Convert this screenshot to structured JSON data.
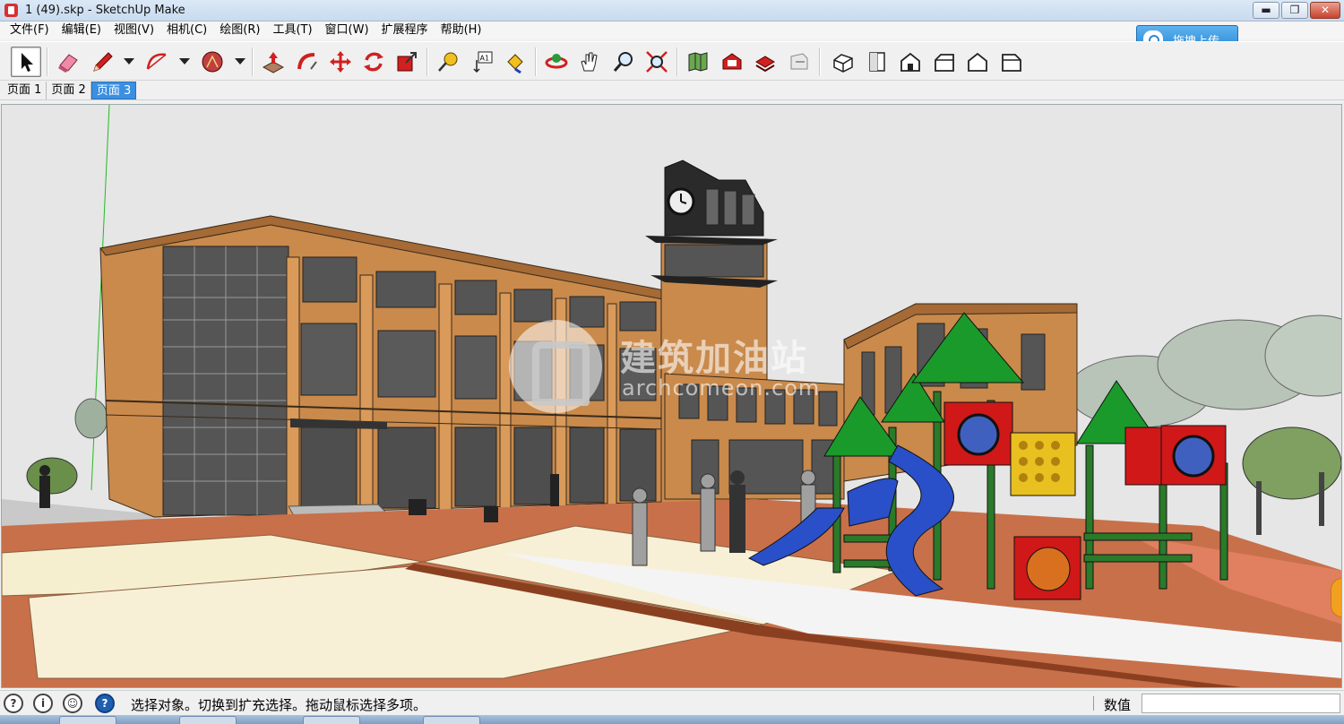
{
  "window": {
    "title": "1 (49).skp - SketchUp Make",
    "buttons": {
      "minimize": "▬",
      "restore": "❐",
      "close": "✕"
    }
  },
  "menu": [
    "文件(F)",
    "编辑(E)",
    "视图(V)",
    "相机(C)",
    "绘图(R)",
    "工具(T)",
    "窗口(W)",
    "扩展程序",
    "帮助(H)"
  ],
  "upload": {
    "label": "拖拽上传",
    "icon": "cloud-upload-icon"
  },
  "toolbar": {
    "tools": [
      {
        "name": "select-tool",
        "icon": "arrow-cursor-icon",
        "active": true
      },
      {
        "name": "eraser-tool",
        "icon": "eraser-icon"
      },
      {
        "name": "line-tool",
        "icon": "pencil-icon"
      },
      {
        "name": "arc-tool",
        "icon": "arc-icon"
      },
      {
        "name": "shape-tool",
        "icon": "polygon-icon"
      },
      {
        "name": "push-pull-tool",
        "icon": "push-pull-icon"
      },
      {
        "name": "follow-me-tool",
        "icon": "follow-me-icon"
      },
      {
        "name": "move-tool",
        "icon": "move-arrows-icon"
      },
      {
        "name": "rotate-tool",
        "icon": "rotate-icon"
      },
      {
        "name": "scale-tool",
        "icon": "scale-icon"
      },
      {
        "name": "tape-measure-tool",
        "icon": "tape-measure-icon"
      },
      {
        "name": "text-tool",
        "icon": "text-label-icon"
      },
      {
        "name": "paint-bucket-tool",
        "icon": "paint-bucket-icon"
      },
      {
        "name": "orbit-tool",
        "icon": "orbit-icon"
      },
      {
        "name": "pan-tool",
        "icon": "hand-icon"
      },
      {
        "name": "zoom-tool",
        "icon": "magnifier-icon"
      },
      {
        "name": "zoom-extents-tool",
        "icon": "zoom-extents-icon"
      },
      {
        "name": "geo-location-tool",
        "icon": "map-icon"
      },
      {
        "name": "warehouse-tool",
        "icon": "warehouse-icon"
      },
      {
        "name": "share-model-tool",
        "icon": "share-model-icon"
      },
      {
        "name": "extension-warehouse-tool",
        "icon": "extension-icon"
      },
      {
        "name": "iso-view",
        "icon": "iso-house-icon"
      },
      {
        "name": "top-view",
        "icon": "top-view-icon"
      },
      {
        "name": "front-view",
        "icon": "front-house-icon"
      },
      {
        "name": "right-view",
        "icon": "right-house-icon"
      },
      {
        "name": "back-view",
        "icon": "back-house-icon"
      },
      {
        "name": "left-view",
        "icon": "left-house-icon"
      }
    ],
    "text_tool_label": "A1"
  },
  "tabs": [
    {
      "label": "页面 1",
      "active": false
    },
    {
      "label": "页面 2",
      "active": false
    },
    {
      "label": "页面 3",
      "active": true
    }
  ],
  "watermark": {
    "cn": "建筑加油站",
    "en": "archcomeon.com"
  },
  "status": {
    "message": "选择对象。切换到扩充选择。拖动鼠标选择多项。",
    "value_label": "数值",
    "value": "",
    "icons": [
      "geo-location-icon",
      "credits-icon",
      "user-icon",
      "help-icon"
    ]
  },
  "colors": {
    "sky": "#e6e6e6",
    "building": "#c98a4c",
    "plaza": "#f7f0d6",
    "brick": "#c8704a",
    "slide": "#2950c8",
    "roof_green": "#1a9a2a",
    "panel_red": "#d01818",
    "panel_yellow": "#e8c020",
    "active_tab": "#3b8fe0"
  }
}
